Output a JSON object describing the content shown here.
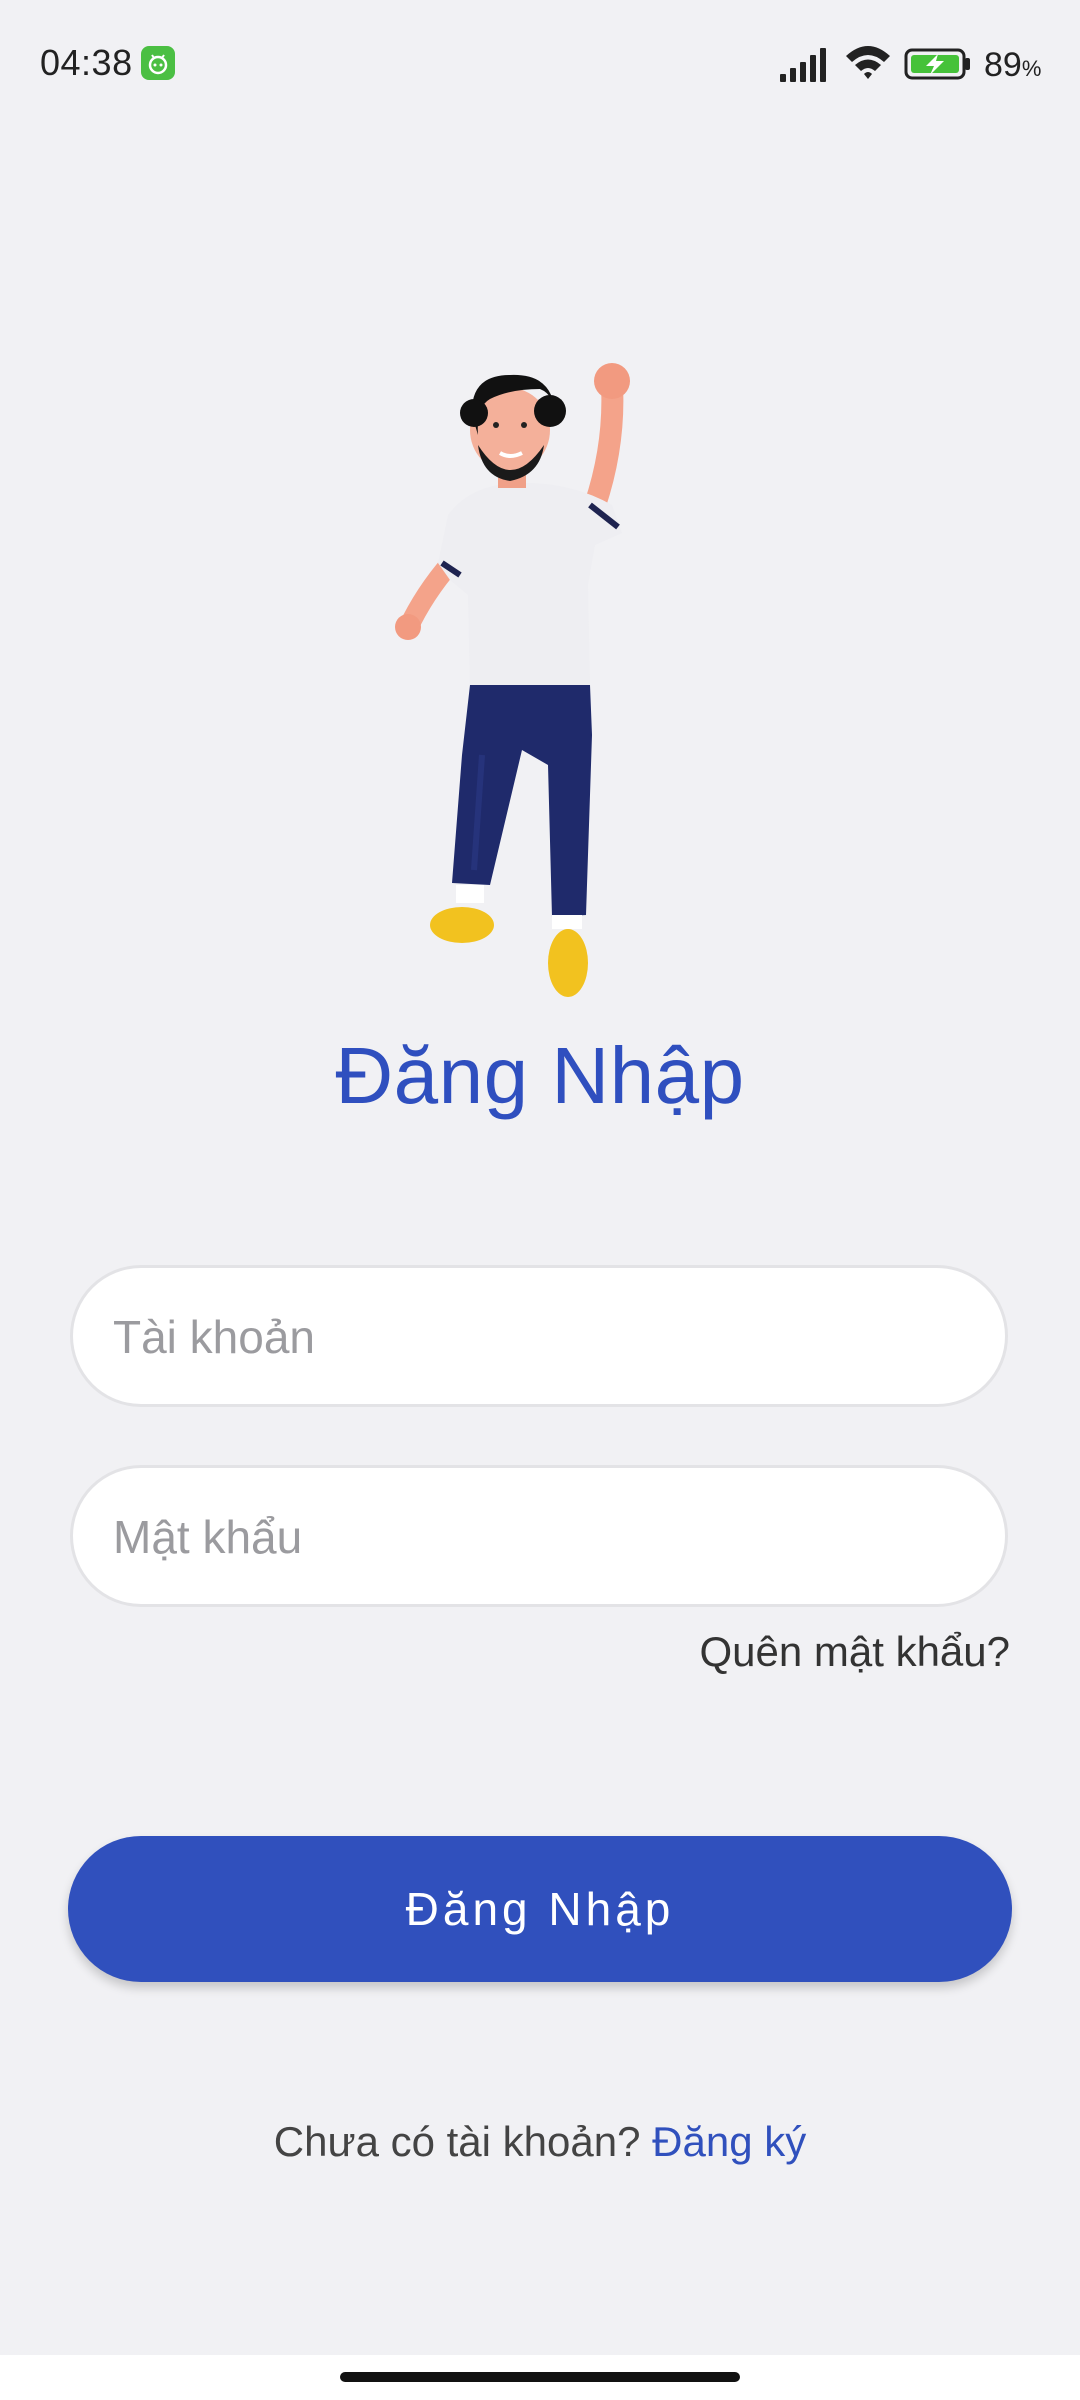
{
  "status_bar": {
    "time": "04:38",
    "app_icon": "android-app-icon",
    "battery_percent": "89",
    "battery_unit": "%",
    "icons": [
      "signal-icon",
      "wifi-icon",
      "battery-charging-icon"
    ]
  },
  "hero": {
    "icon": "cheering-man-illustration"
  },
  "login": {
    "title": "Đăng Nhập",
    "username_placeholder": "Tài khoản",
    "password_placeholder": "Mật khẩu",
    "forgot_password": "Quên mật khẩu?",
    "submit_label": "Đăng Nhập",
    "no_account_text": "Chưa có tài khoản?",
    "register_link": "Đăng ký"
  },
  "colors": {
    "accent": "#3050bd",
    "background": "#f1f1f4"
  }
}
